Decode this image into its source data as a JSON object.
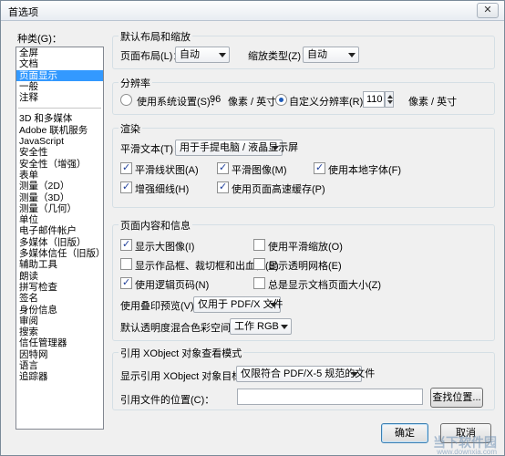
{
  "window": {
    "title": "首选项",
    "close_glyph": "✕"
  },
  "categories": {
    "label": "种类(G)：",
    "top": [
      "全屏",
      "文档",
      "页面显示",
      "一般",
      "注释"
    ],
    "selected_index": 2,
    "rest": [
      "3D 和多媒体",
      "Adobe 联机服务",
      "JavaScript",
      "安全性",
      "安全性（增强）",
      "表单",
      "测量（2D）",
      "测量（3D）",
      "测量（几何）",
      "单位",
      "电子邮件帐户",
      "多媒体（旧版）",
      "多媒体信任（旧版）",
      "辅助工具",
      "朗读",
      "拼写检查",
      "签名",
      "身份信息",
      "审阅",
      "搜索",
      "信任管理器",
      "因特网",
      "语言",
      "追踪器"
    ]
  },
  "layout_group": {
    "title": "默认布局和缩放",
    "page_layout_label": "页面布局(L)：",
    "page_layout_value": "自动",
    "zoom_label": "缩放类型(Z)：",
    "zoom_value": "自动"
  },
  "resolution_group": {
    "title": "分辨率",
    "system_label": "使用系统设置(S)：",
    "system_value": "96",
    "unit1": "像素 / 英寸",
    "custom_label": "自定义分辨率(R)：",
    "custom_value": "110",
    "unit2": "像素 / 英寸",
    "custom_selected": true
  },
  "render_group": {
    "title": "渲染",
    "smooth_text_label": "平滑文本(T)：",
    "smooth_text_value": "用于手提电脑 / 液晶显示屏",
    "checks": [
      {
        "label": "平滑线状图(A)",
        "checked": true
      },
      {
        "label": "平滑图像(M)",
        "checked": true
      },
      {
        "label": "使用本地字体(F)",
        "checked": true
      },
      {
        "label": "增强细线(H)",
        "checked": true
      },
      {
        "label": "使用页面高速缓存(P)",
        "checked": true
      }
    ]
  },
  "page_content_group": {
    "title": "页面内容和信息",
    "checks": [
      {
        "label": "显示大图像(I)",
        "checked": true
      },
      {
        "label": "使用平滑缩放(O)",
        "checked": false
      },
      {
        "label": "显示作品框、裁切框和出血框(B)",
        "checked": false
      },
      {
        "label": "显示透明网格(E)",
        "checked": false
      },
      {
        "label": "使用逻辑页码(N)",
        "checked": true
      },
      {
        "label": "总是显示文档页面大小(Z)",
        "checked": false
      }
    ],
    "overprint_label": "使用叠印预览(V)：",
    "overprint_value": "仅用于 PDF/X 文件",
    "blend_label": "默认透明度混合色彩空间(C)：",
    "blend_value": "工作 RGB"
  },
  "xobject_group": {
    "title": "引用 XObject 对象查看模式",
    "target_label": "显示引用 XObject 对象目标(X)：",
    "target_value": "仅限符合 PDF/X-5 规范的文件",
    "location_label": "引用文件的位置(C)：",
    "location_value": "",
    "browse_label": "查找位置..."
  },
  "buttons": {
    "ok": "确定",
    "cancel": "取消"
  },
  "watermark": {
    "text": "当下软件园",
    "url": "www.downxia.com"
  }
}
